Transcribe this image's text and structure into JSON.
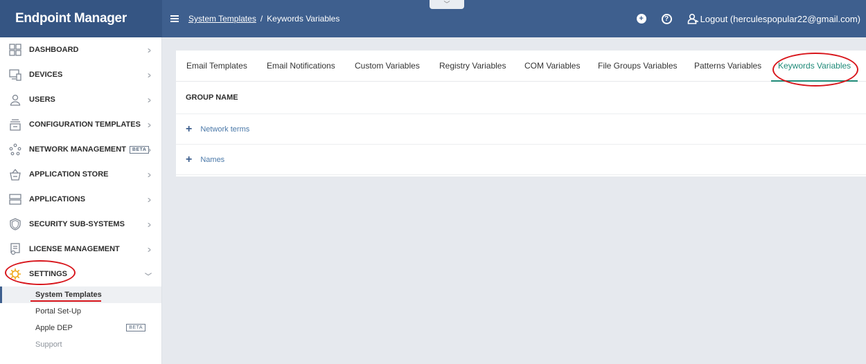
{
  "app": {
    "title": "Endpoint Manager"
  },
  "breadcrumb": {
    "parent": "System Templates",
    "separator": "/",
    "current": "Keywords Variables"
  },
  "header": {
    "logout_label": "Logout (herculespopular22@gmail.com)",
    "help_glyph": "?",
    "add_glyph": "+"
  },
  "sidebar": {
    "items": [
      {
        "label": "DASHBOARD",
        "icon": "dashboard-icon"
      },
      {
        "label": "DEVICES",
        "icon": "devices-icon"
      },
      {
        "label": "USERS",
        "icon": "user-icon"
      },
      {
        "label": "CONFIGURATION TEMPLATES",
        "icon": "templates-icon"
      },
      {
        "label": "NETWORK MANAGEMENT",
        "icon": "network-icon",
        "badge": "BETA"
      },
      {
        "label": "APPLICATION STORE",
        "icon": "store-icon"
      },
      {
        "label": "APPLICATIONS",
        "icon": "applications-icon"
      },
      {
        "label": "SECURITY SUB-SYSTEMS",
        "icon": "shield-icon"
      },
      {
        "label": "LICENSE MANAGEMENT",
        "icon": "license-icon"
      }
    ],
    "settings": {
      "label": "SETTINGS",
      "icon": "gear-icon"
    },
    "sub_items": [
      {
        "label": "System Templates"
      },
      {
        "label": "Portal Set-Up"
      },
      {
        "label": "Apple DEP",
        "badge": "BETA"
      },
      {
        "label": "Support"
      }
    ]
  },
  "tabs": [
    {
      "label": "Email Templates"
    },
    {
      "label": "Email Notifications"
    },
    {
      "label": "Custom Variables"
    },
    {
      "label": "Registry Variables"
    },
    {
      "label": "COM Variables"
    },
    {
      "label": "File Groups Variables"
    },
    {
      "label": "Patterns Variables"
    },
    {
      "label": "Keywords Variables"
    }
  ],
  "table": {
    "column_header": "GROUP NAME",
    "rows": [
      {
        "name": "Network terms"
      },
      {
        "name": "Names"
      }
    ]
  },
  "colors": {
    "header": "#3e5f8e",
    "accent": "#1f8a78",
    "highlight": "#d8161c",
    "settings_icon": "#f0a818"
  }
}
